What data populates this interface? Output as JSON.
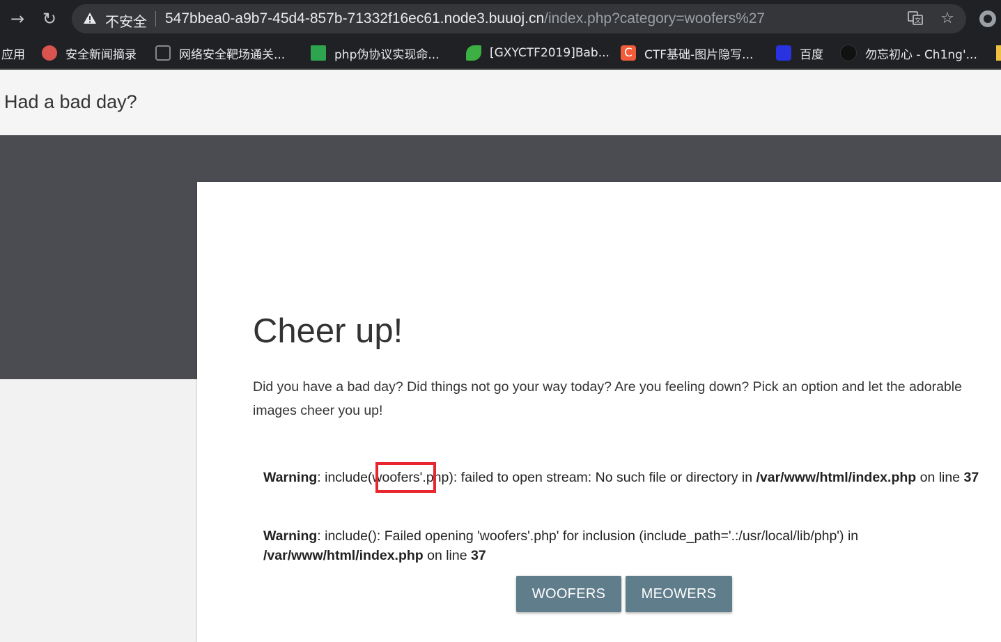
{
  "browser": {
    "security_label": "不安全",
    "url_host": "547bbea0-a9b7-45d4-857b-71332f16ec61.node3.buuoj.cn",
    "url_path": "/index.php?category=woofers%27"
  },
  "bookmarks": [
    {
      "label": "应用",
      "icon": "apps-icon",
      "color": ""
    },
    {
      "label": "安全新闻摘录",
      "icon": "news-icon",
      "color": "#d9534f"
    },
    {
      "label": "网络安全靶场通关...",
      "icon": "target-icon",
      "color": "#888888"
    },
    {
      "label": "php伪协议实现命...",
      "icon": "doc-icon",
      "color": "#2ea44f"
    },
    {
      "label": "[GXYCTF2019]Bab...",
      "icon": "leaf-icon",
      "color": "#3cb043"
    },
    {
      "label": "CTF基础-图片隐写...",
      "icon": "csdn-icon",
      "color": "#f25c3a"
    },
    {
      "label": "百度",
      "icon": "baidu-icon",
      "color": "#2932e1"
    },
    {
      "label": "勿忘初心 - Ch1ng'...",
      "icon": "github-icon",
      "color": "#111111"
    }
  ],
  "page": {
    "brand": "Had a bad day?",
    "title": "Cheer up!",
    "intro": "Did you have a bad day? Did things not go your way today? Are you feeling down? Pick an option and let the adorable images cheer you up!",
    "warning1": {
      "label": "Warning",
      "text_a": ": include(woofers'.php): failed to open stream: No such file or directory in ",
      "path": "/var/www/html/index.php",
      "text_b": " on line ",
      "line": "37"
    },
    "warning2": {
      "label": "Warning",
      "text_a": ": include(): Failed opening 'woofers'.php' for inclusion (include_path='.:/usr/local/lib/php') in ",
      "path": "/var/www/html/index.php",
      "text_b": " on line ",
      "line": "37"
    },
    "buttons": {
      "woofers": "WOOFERS",
      "meowers": "MEOWERS"
    }
  },
  "colors": {
    "button": "#607d8b",
    "highlight": "#e8262f",
    "hero": "#4a4c52"
  }
}
